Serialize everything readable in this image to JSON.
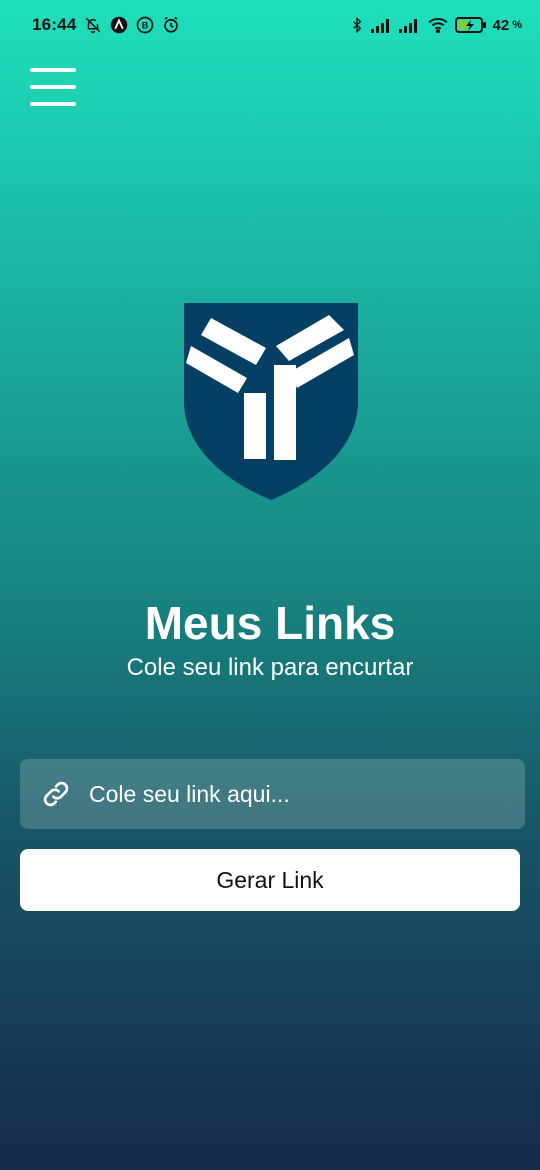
{
  "status_bar": {
    "time": "16:44",
    "battery_level": "42",
    "battery_unit": "%",
    "icons": [
      "bell-off-icon",
      "a-badge-icon",
      "b-badge-icon",
      "alarm-icon",
      "bluetooth-icon",
      "signal-icon",
      "signal-icon",
      "wifi-icon",
      "battery-charging-icon"
    ]
  },
  "header": {
    "menu_icon": "hamburger-menu-icon"
  },
  "logo": {
    "icon": "shield-logo-icon",
    "colors": {
      "shield": "#053f63",
      "mark": "#ffffff"
    }
  },
  "main": {
    "title": "Meus Links",
    "subtitle": "Cole seu link para encurtar",
    "input": {
      "icon": "link-icon",
      "value": "",
      "placeholder": "Cole seu link aqui..."
    },
    "button_label": "Gerar Link"
  },
  "colors": {
    "gradient_top": "#1ee0bc",
    "gradient_bottom": "#162a4a",
    "button_bg": "#ffffff"
  }
}
